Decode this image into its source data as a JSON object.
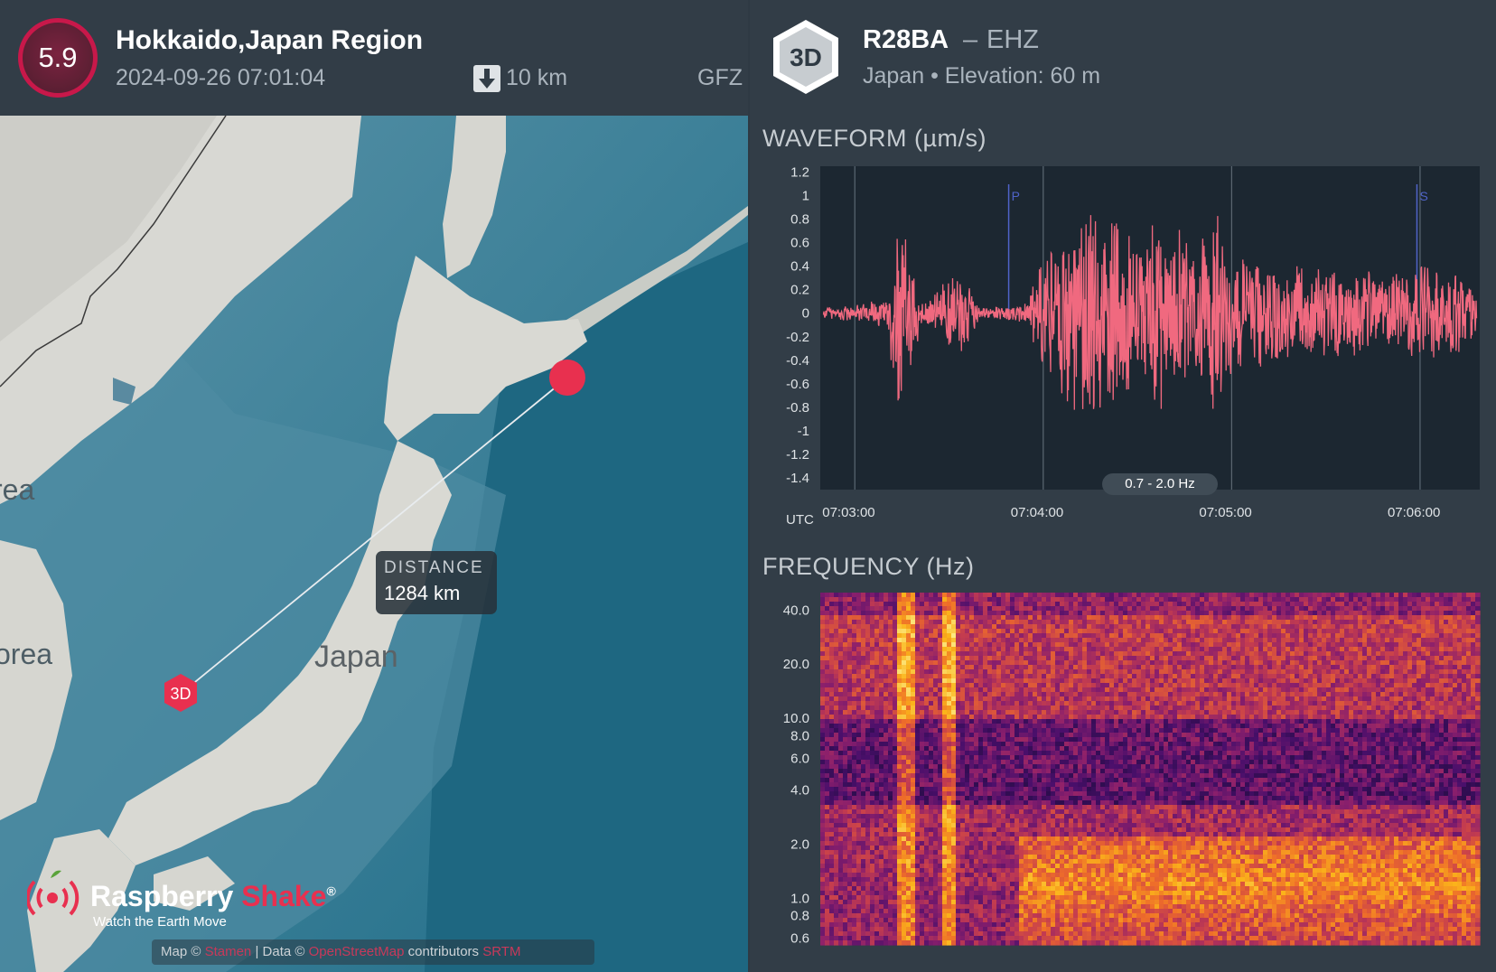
{
  "event": {
    "magnitude": "5.9",
    "title": "Hokkaido,Japan Region",
    "datetime": "2024-09-26 07:01:04",
    "depth": "10 km",
    "agency": "GFZ"
  },
  "map": {
    "distance_label": "DISTANCE",
    "distance_value": "1284 km",
    "labels": [
      "rea",
      "orea",
      "Japan"
    ],
    "station_marker": "3D",
    "brand": {
      "name_part1": "Raspberry ",
      "name_part2": "Shake",
      "reg": "®",
      "tagline": "Watch the Earth Move"
    },
    "attribution": {
      "map_prefix": "Map © ",
      "map_link": "Stamen",
      "data_prefix": " | Data © ",
      "data_link": "OpenStreetMap",
      "suffix": " contributors ",
      "extra_link": "SRTM"
    }
  },
  "station": {
    "badge": "3D",
    "id": "R28BA",
    "separator": "–",
    "channel": "EHZ",
    "location": "Japan",
    "elevation": "Elevation: 60 m"
  },
  "waveform": {
    "title": "WAVEFORM (µm/s)",
    "filter": "0.7 - 2.0 Hz",
    "utc_label": "UTC",
    "phase_p": "P",
    "phase_s": "S"
  },
  "frequency": {
    "title": "FREQUENCY (Hz)"
  },
  "chart_data": [
    {
      "type": "line",
      "title": "WAVEFORM (µm/s)",
      "xlabel": "UTC",
      "ylabel": "µm/s",
      "y_ticks": [
        "1.2",
        "1",
        "0.8",
        "0.6",
        "0.4",
        "0.2",
        "0",
        "-0.2",
        "-0.4",
        "-0.6",
        "-0.8",
        "-1",
        "-1.2",
        "-1.4"
      ],
      "ylim": [
        -1.5,
        1.25
      ],
      "x_ticks": [
        "07:03:00",
        "07:04:00",
        "07:05:00",
        "07:06:00"
      ],
      "xlim": [
        "07:02:49",
        "07:06:19"
      ],
      "phase_markers": [
        {
          "label": "P",
          "time": "07:03:49"
        },
        {
          "label": "S",
          "time": "07:05:59"
        }
      ],
      "color": "#f0697f",
      "series": [
        {
          "x_times": [
            "07:02:50",
            "07:03:00",
            "07:03:10",
            "07:03:14",
            "07:03:18",
            "07:03:22",
            "07:03:30",
            "07:03:36",
            "07:03:40",
            "07:03:45",
            "07:03:50",
            "07:03:55",
            "07:04:00",
            "07:04:05",
            "07:04:10",
            "07:04:15",
            "07:04:20",
            "07:04:25",
            "07:04:30",
            "07:04:35",
            "07:04:40",
            "07:04:45",
            "07:04:50",
            "07:04:55",
            "07:05:00",
            "07:05:10",
            "07:05:20",
            "07:05:30",
            "07:05:40",
            "07:05:50",
            "07:06:00",
            "07:06:10",
            "07:06:18"
          ],
          "envelope": [
            0.06,
            0.08,
            0.15,
            0.9,
            0.55,
            0.08,
            0.4,
            0.3,
            0.05,
            0.06,
            0.08,
            0.1,
            0.55,
            0.75,
            0.9,
            1.05,
            0.95,
            0.85,
            0.7,
            0.95,
            0.85,
            0.75,
            0.65,
            1.0,
            0.55,
            0.5,
            0.45,
            0.42,
            0.4,
            0.35,
            0.45,
            0.4,
            0.3
          ]
        }
      ]
    },
    {
      "type": "heatmap",
      "title": "FREQUENCY (Hz)",
      "ylabel": "Hz",
      "y_ticks": [
        "40.0",
        "20.0",
        "10.0",
        "8.0",
        "6.0",
        "4.0",
        "2.0",
        "1.0",
        "0.8",
        "0.6"
      ],
      "y_scale": "log",
      "ylim": [
        0.55,
        50
      ],
      "xlim": [
        "07:02:49",
        "07:06:19"
      ],
      "colormap": [
        "#1a0b3a",
        "#4a0f6b",
        "#8a1f6c",
        "#c43c4f",
        "#ee6c2a",
        "#fbb41a",
        "#fcf08f"
      ]
    }
  ]
}
